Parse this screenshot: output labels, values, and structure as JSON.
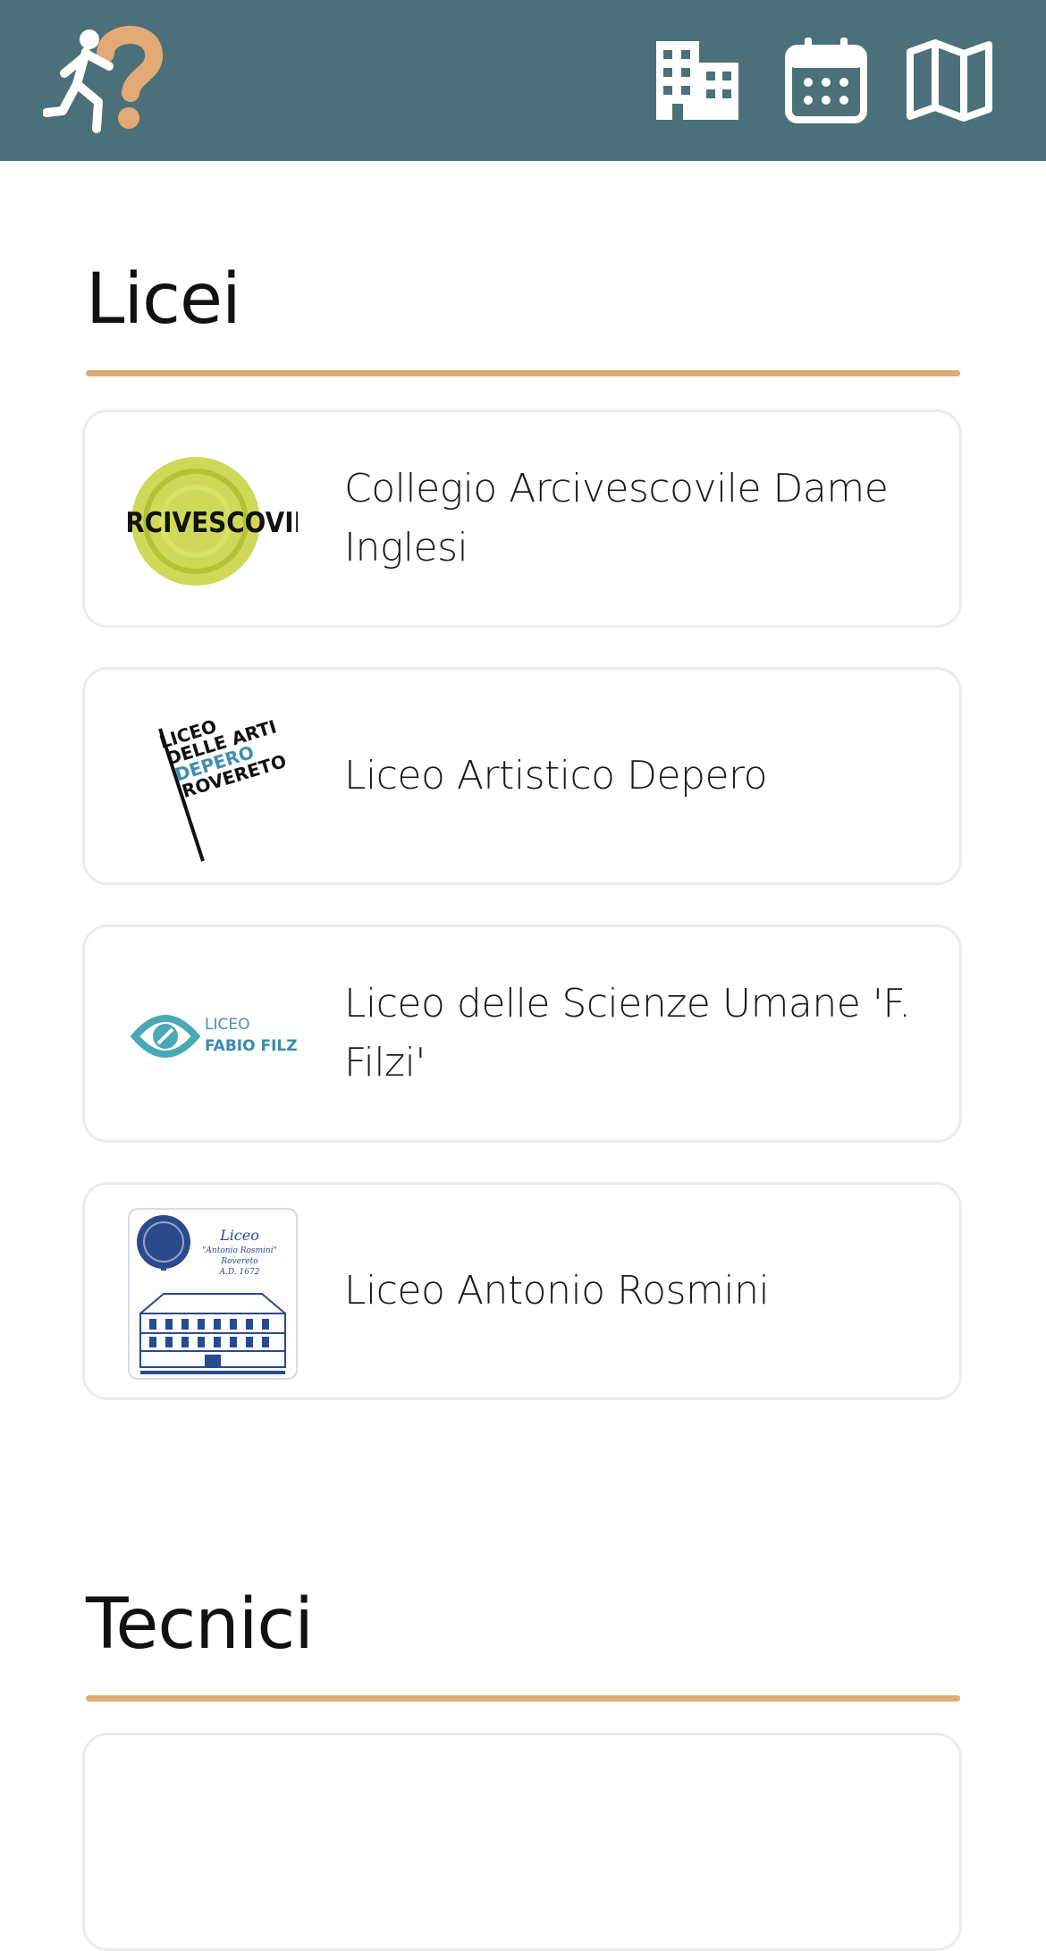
{
  "header": {
    "logo_icon": "running-question-logo-icon",
    "nav": [
      {
        "id": "schools",
        "icon": "building-icon"
      },
      {
        "id": "calendar",
        "icon": "calendar-icon"
      },
      {
        "id": "map",
        "icon": "map-icon"
      }
    ]
  },
  "colors": {
    "header_bg": "#4b7079",
    "accent": "#e2aa76",
    "text": "#1a1a1a"
  },
  "sections": [
    {
      "title": "Licei",
      "items": [
        {
          "name": "Collegio Arcivescovile Dame Inglesi",
          "logo_text": "ARCIVESCOVILE"
        },
        {
          "name": "Liceo Artistico Depero",
          "logo_text": [
            "LICEO",
            "DELLE ARTI",
            "DEPERO",
            "ROVERETO"
          ]
        },
        {
          "name": "Liceo delle Scienze Umane 'F. Filzi'",
          "logo_text": [
            "LICEO",
            "FABIO FILZI"
          ]
        },
        {
          "name": "Liceo Antonio Rosmini",
          "logo_text": [
            "Liceo",
            "\"Antonio Rosmini\"",
            "Rovereto",
            "A.D. 1672"
          ]
        }
      ]
    },
    {
      "title": "Tecnici",
      "items": []
    }
  ]
}
